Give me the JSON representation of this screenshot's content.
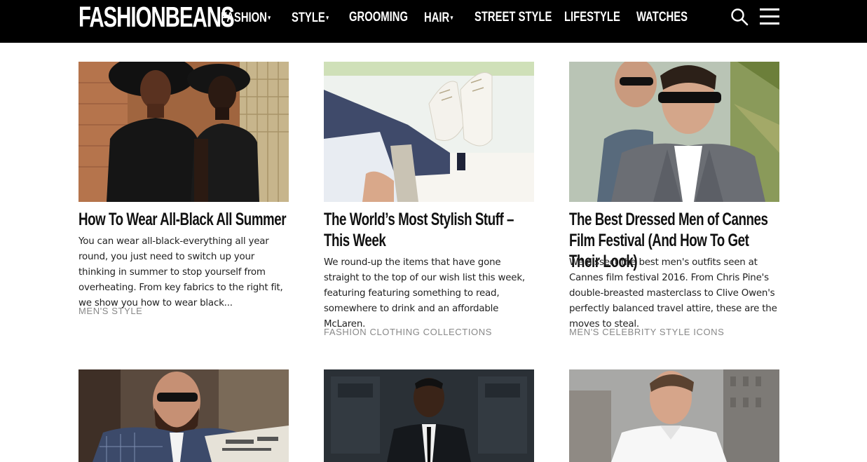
{
  "header": {
    "logo": "FASHIONBEANS",
    "nav": [
      {
        "label": "FASHION",
        "has_dropdown": true
      },
      {
        "label": "STYLE",
        "has_dropdown": true
      },
      {
        "label": "GROOMING",
        "has_dropdown": false
      },
      {
        "label": "HAIR",
        "has_dropdown": true
      },
      {
        "label": "STREET STYLE",
        "has_dropdown": false
      },
      {
        "label": "LIFESTYLE",
        "has_dropdown": false
      },
      {
        "label": "WATCHES",
        "has_dropdown": false
      }
    ],
    "caret": "▾",
    "search_icon": "search-icon",
    "menu_icon": "hamburger-menu-icon"
  },
  "articles": [
    {
      "title": "How To Wear All-Black All Summer",
      "excerpt": "You can wear all-black-everything all year round, you just need to switch up your thinking in summer to stop yourself from overheating. From key fabrics to the right fit, we show you how to wear black...",
      "category": "MEN'S STYLE"
    },
    {
      "title": "The World’s Most Stylish Stuff – This Week",
      "excerpt": "We round-up the items that have gone straight to the top of our wish list this week, featuring featuring something to read, somewhere to drink and an affordable McLaren.",
      "category": "FASHION CLOTHING COLLECTIONS"
    },
    {
      "title": "The Best Dressed Men of Cannes Film Festival (And How To Get Their Look)",
      "excerpt": "We dissect the best men's outfits seen at Cannes film festival 2016. From Chris Pine's double-breasted masterclass to Clive Owen's perfectly balanced travel attire, these are the moves to steal.",
      "category": "MEN'S CELEBRITY STYLE ICONS"
    },
    {
      "title": "",
      "excerpt": "",
      "category": ""
    },
    {
      "title": "",
      "excerpt": "",
      "category": ""
    },
    {
      "title": "",
      "excerpt": "",
      "category": ""
    }
  ],
  "colors": {
    "header_bg": "#000000",
    "header_text": "#ffffff",
    "body_text": "#222222",
    "category_text": "#888888"
  }
}
